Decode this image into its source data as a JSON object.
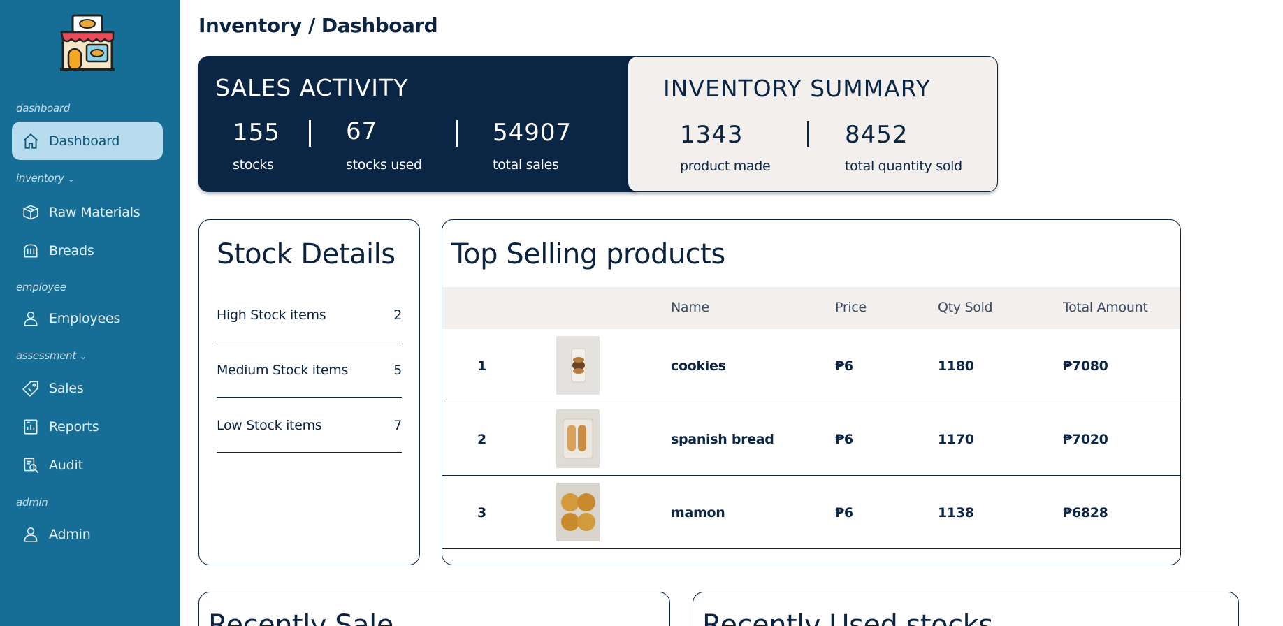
{
  "sidebar": {
    "sections": {
      "dashboard": "dashboard",
      "inventory": "inventory",
      "employee": "employee",
      "assessment": "assessment",
      "admin": "admin"
    },
    "items": {
      "dashboard": "Dashboard",
      "raw_materials": "Raw Materials",
      "breads": "Breads",
      "employees": "Employees",
      "sales": "Sales",
      "reports": "Reports",
      "audit": "Audit",
      "admin": "Admin"
    },
    "colors": {
      "background": "#166e97",
      "active_bg": "#b7dced"
    }
  },
  "header": {
    "breadcrumb": "Inventory / Dashboard"
  },
  "sales_activity": {
    "title": "SALES ACTIVITY",
    "stats": [
      {
        "value": "155",
        "label": "stocks"
      },
      {
        "value": "67",
        "label": "stocks used"
      },
      {
        "value": "54907",
        "label": "total sales"
      }
    ]
  },
  "inventory_summary": {
    "title": "INVENTORY SUMMARY",
    "stats": [
      {
        "value": "1343",
        "label": "product made"
      },
      {
        "value": "8452",
        "label": "total quantity sold"
      }
    ]
  },
  "stock_details": {
    "title": "Stock Details",
    "rows": [
      {
        "label": "High Stock items",
        "count": "2"
      },
      {
        "label": "Medium Stock items",
        "count": "5"
      },
      {
        "label": "Low Stock items",
        "count": "7"
      }
    ]
  },
  "top_selling": {
    "title": "Top Selling products",
    "columns": [
      "Name",
      "Price",
      "Qty Sold",
      "Total Amount"
    ],
    "rows": [
      {
        "rank": "1",
        "image": "cookies-photo",
        "name": "cookies",
        "price": "₱6",
        "qty": "1180",
        "total": "₱7080"
      },
      {
        "rank": "2",
        "image": "spanish-bread-photo",
        "name": "spanish bread",
        "price": "₱6",
        "qty": "1170",
        "total": "₱7020"
      },
      {
        "rank": "3",
        "image": "mamon-photo",
        "name": "mamon",
        "price": "₱6",
        "qty": "1138",
        "total": "₱6828"
      }
    ]
  },
  "recent_sale": {
    "title": "Recently Sale"
  },
  "recent_used": {
    "title": "Recently Used stocks"
  },
  "colors": {
    "navy": "#0b2545",
    "panel_light": "#f2efed"
  }
}
